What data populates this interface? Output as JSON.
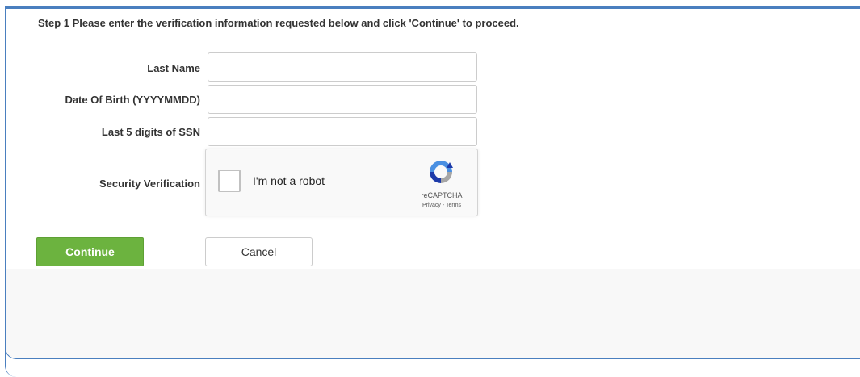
{
  "step_text": "Step 1 Please enter the verification information requested below and click 'Continue' to proceed.",
  "form": {
    "last_name": {
      "label": "Last Name",
      "value": ""
    },
    "dob": {
      "label": "Date Of Birth (YYYYMMDD)",
      "value": ""
    },
    "ssn": {
      "label": "Last 5 digits of SSN",
      "value": ""
    },
    "security": {
      "label": "Security Verification"
    }
  },
  "captcha": {
    "checkbox_label": "I'm not a robot",
    "brand": "reCAPTCHA",
    "links": "Privacy - Terms",
    "icon": "recaptcha-icon"
  },
  "buttons": {
    "continue": "Continue",
    "cancel": "Cancel"
  },
  "colors": {
    "accent_border": "#4a7fbf",
    "continue_bg": "#6cb33f"
  }
}
